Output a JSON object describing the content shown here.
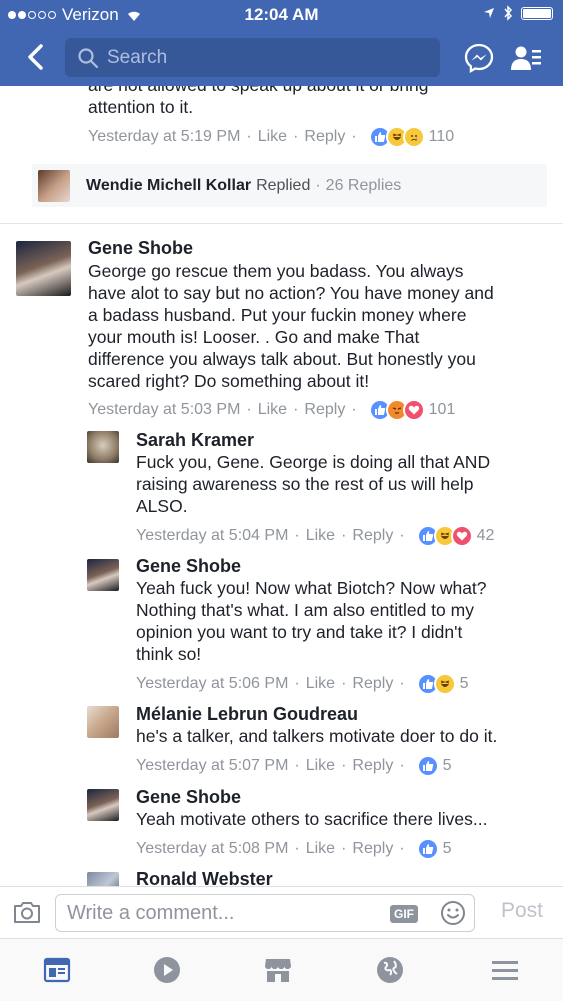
{
  "status": {
    "carrier": "Verizon",
    "time": "12:04 AM"
  },
  "nav": {
    "search_placeholder": "Search"
  },
  "top_comment": {
    "text_cut": "are not allowed to speak up about it or bring",
    "text": "attention to it.",
    "time": "Yesterday at 5:19 PM",
    "like": "Like",
    "reply": "Reply",
    "count": "110"
  },
  "reply_summary": {
    "name": "Wendie Michell Kollar",
    "action": "Replied",
    "count": "26 Replies"
  },
  "main_comment": {
    "name": "Gene Shobe",
    "lines": [
      "George go rescue them you badass. You always",
      "have alot to say but no action? You have money and",
      "a badass husband. Put your fuckin money where",
      "your mouth is! Looser. . Go and make That",
      "difference you always talk about. But honestly you",
      "scared right? Do something about it!"
    ],
    "time": "Yesterday at 5:03 PM",
    "like": "Like",
    "reply": "Reply",
    "count": "101"
  },
  "replies": [
    {
      "name": "Sarah Kramer",
      "lines": [
        "Fuck you, Gene. George is doing all that AND",
        "raising awareness so the rest of us will help",
        "ALSO."
      ],
      "time": "Yesterday at 5:04 PM",
      "like": "Like",
      "reply": "Reply",
      "count": "42"
    },
    {
      "name": "Gene Shobe",
      "lines": [
        "Yeah fuck you! Now what Biotch? Now what?",
        "Nothing that's what. I am also entitled to my",
        "opinion you want to try and take it? I didn't",
        "think so!"
      ],
      "time": "Yesterday at 5:06 PM",
      "like": "Like",
      "reply": "Reply",
      "count": "5"
    },
    {
      "name": "Mélanie Lebrun Goudreau",
      "lines": [
        "he's a talker, and talkers motivate doer to do it."
      ],
      "time": "Yesterday at 5:07 PM",
      "like": "Like",
      "reply": "Reply",
      "count": "5"
    },
    {
      "name": "Gene Shobe",
      "lines": [
        "Yeah motivate others to sacrifice there lives..."
      ],
      "time": "Yesterday at 5:08 PM",
      "like": "Like",
      "reply": "Reply",
      "count": "5"
    },
    {
      "name": "Ronald Webster"
    }
  ],
  "composer": {
    "placeholder": "Write a comment...",
    "gif": "GIF",
    "post": "Post"
  },
  "colors": {
    "brand": "#4267b2",
    "like": "#5890ff",
    "meta": "#90949c"
  },
  "icons": [
    "back-icon",
    "search-icon",
    "messenger-icon",
    "friend-requests-icon",
    "camera-icon",
    "smiley-icon",
    "news-feed-icon",
    "video-icon",
    "marketplace-icon",
    "notifications-globe-icon",
    "menu-icon"
  ]
}
